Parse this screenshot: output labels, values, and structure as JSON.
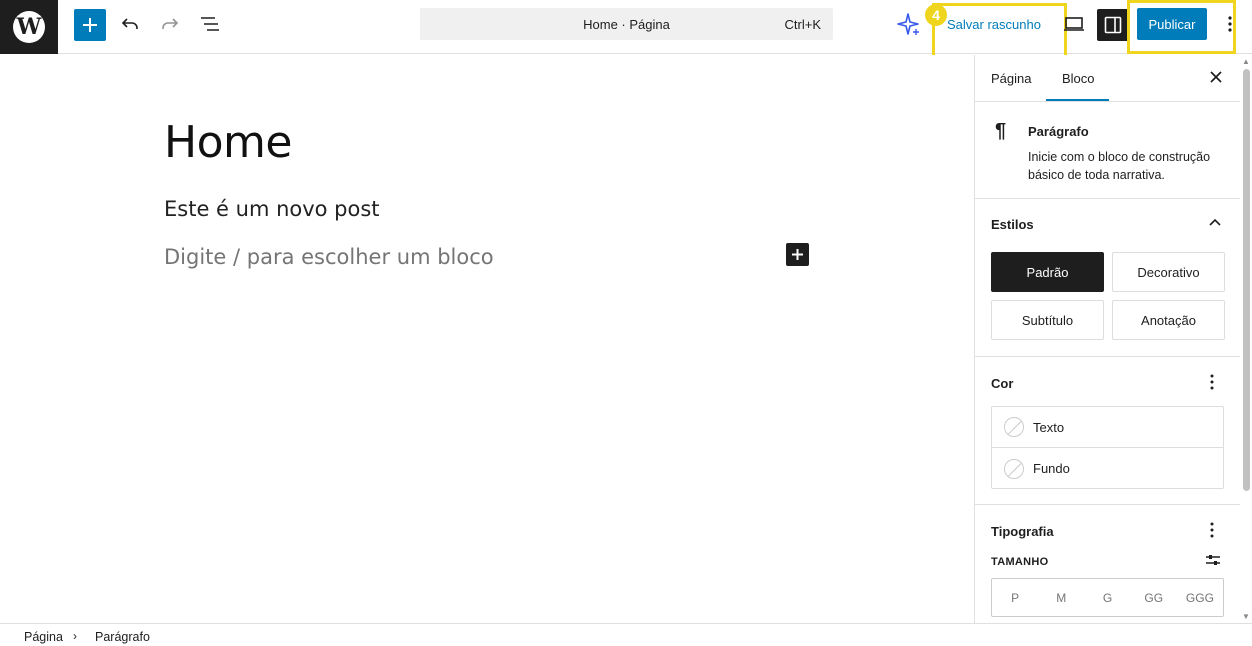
{
  "topbar": {
    "logo_letter": "W",
    "command_title": "Home · Página",
    "command_shortcut": "Ctrl+K",
    "badge_number": "4",
    "save_draft_label": "Salvar rascunho",
    "publish_label": "Publicar"
  },
  "editor": {
    "title": "Home",
    "paragraph": "Este é um  novo post",
    "placeholder": "Digite / para escolher um bloco"
  },
  "sidebar": {
    "tabs": [
      {
        "label": "Página"
      },
      {
        "label": "Bloco"
      }
    ],
    "block": {
      "name": "Parágrafo",
      "description": "Inicie com o bloco de construção básico de toda narrativa."
    },
    "styles": {
      "heading": "Estilos",
      "options": [
        {
          "label": "Padrão"
        },
        {
          "label": "Decorativo"
        },
        {
          "label": "Subtítulo"
        },
        {
          "label": "Anotação"
        }
      ]
    },
    "color": {
      "heading": "Cor",
      "items": [
        {
          "label": "Texto"
        },
        {
          "label": "Fundo"
        }
      ]
    },
    "typography": {
      "heading": "Tipografia",
      "size_label": "TAMANHO",
      "sizes": [
        "P",
        "M",
        "G",
        "GG",
        "GGG"
      ]
    }
  },
  "breadcrumb": [
    "Página",
    "Parágrafo"
  ],
  "colors": {
    "accent": "#007cba",
    "highlight": "#f0d51e",
    "dark": "#1e1e1e"
  }
}
